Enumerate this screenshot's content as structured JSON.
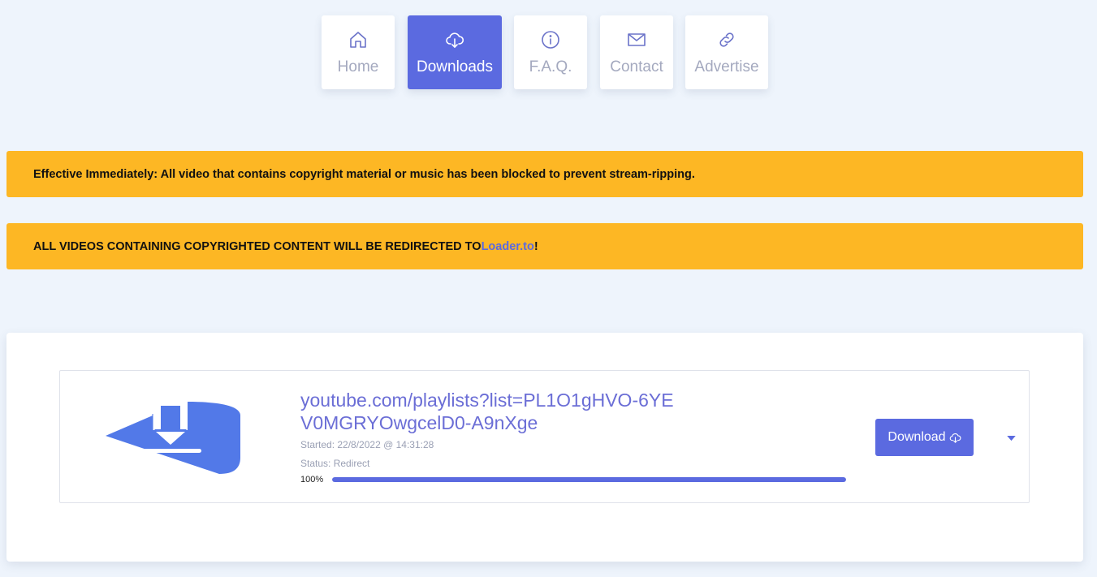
{
  "nav": {
    "items": [
      {
        "label": "Home",
        "icon": "home-icon"
      },
      {
        "label": "Downloads",
        "icon": "cloud-download-icon",
        "active": true
      },
      {
        "label": "F.A.Q.",
        "icon": "info-circle-icon"
      },
      {
        "label": "Contact",
        "icon": "mail-icon"
      },
      {
        "label": "Advertise",
        "icon": "link-icon"
      }
    ]
  },
  "alerts": {
    "notice_1": "Effective Immediately: All video that contains copyright material or music has been blocked to prevent stream-ripping.",
    "notice_2_prefix": "ALL VIDEOS CONTAINING COPYRIGHTED CONTENT WILL BE REDIRECTED TO ",
    "notice_2_link": "Loader.to",
    "notice_2_suffix": "!"
  },
  "download": {
    "url": "youtube.com/playlists?list=PL1O1gHVO-6YEV0MGRYOwgcelD0-A9nXge",
    "started": "Started: 22/8/2022 @ 14:31:28",
    "status": "Status: Redirect",
    "progress_label": "100%",
    "progress": 1.0,
    "button_label": "Download",
    "thumbnail_icon": "download-logo-icon"
  },
  "colors": {
    "accent": "#5b6ae0",
    "alert_bg": "#fdb724",
    "page_bg": "#eef4fc"
  }
}
